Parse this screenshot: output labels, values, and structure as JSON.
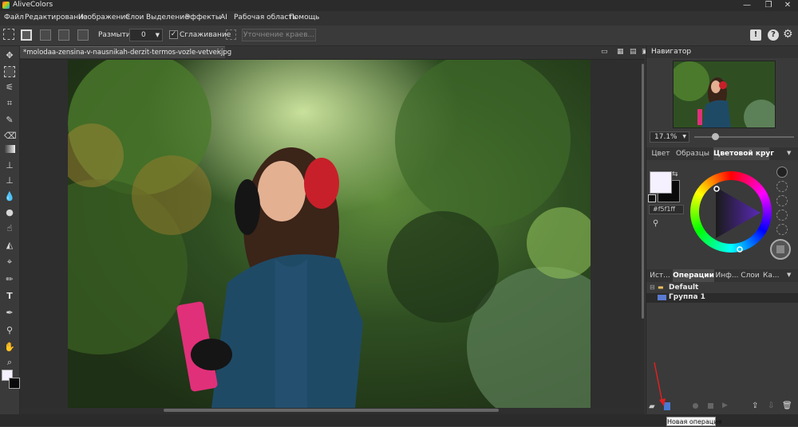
{
  "app": {
    "title": "AliveColors"
  },
  "window_controls": {
    "minimize": "—",
    "maximize": "❐",
    "close": "✕"
  },
  "menu": [
    "Файл",
    "Редактирование",
    "Изображение",
    "Слои",
    "Выделение",
    "Эффекты",
    "AI",
    "Рабочая область",
    "Помощь"
  ],
  "toolbar": {
    "blur_label": "Размытие",
    "blur_value": "0",
    "smoothing_label": "Сглаживание",
    "smoothing_checked": "✓",
    "refine_label": "Уточнение краев..."
  },
  "document": {
    "tab_title": "*molodaa-zensina-v-nausnikah-derzit-termos-vozle-vetvei.jpg",
    "tab_close": "×"
  },
  "navigator": {
    "title": "Навигатор",
    "zoom": "17.1%"
  },
  "color_panel": {
    "tabs": [
      "Цвет",
      "Образцы",
      "Цветовой круг"
    ],
    "active_tab": 2,
    "hex": "#f5f1ff",
    "foreground": "#f5f1ff",
    "background": "#0a0a0a"
  },
  "ops_panel": {
    "tabs": [
      "Ист...",
      "Операции",
      "Инф...",
      "Слои",
      "Ка..."
    ],
    "active_tab": 1,
    "items": [
      {
        "label": "Default"
      },
      {
        "label": "Группа 1"
      }
    ]
  },
  "tooltip": "Новая операция"
}
